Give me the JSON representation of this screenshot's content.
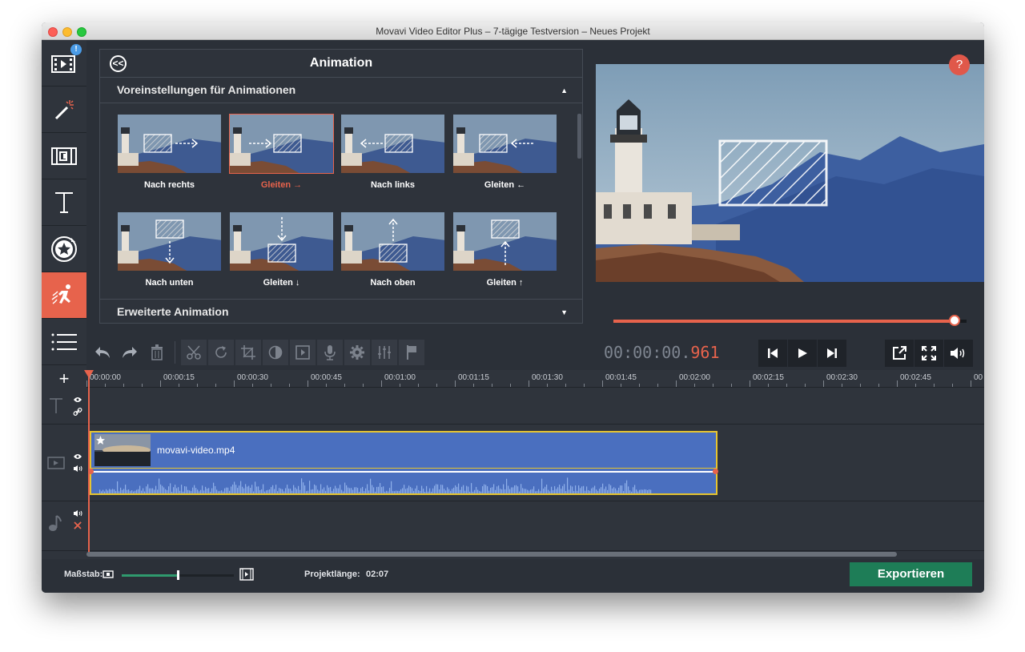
{
  "window": {
    "title": "Movavi Video Editor Plus – 7-tägige Testversion – Neues Projekt"
  },
  "sidebar": {
    "items": [
      {
        "name": "import-media",
        "icon": "film-import-icon",
        "badge": "!"
      },
      {
        "name": "magic-enhance",
        "icon": "magic-wand-icon"
      },
      {
        "name": "transitions",
        "icon": "transition-film-icon"
      },
      {
        "name": "titles",
        "icon": "text-t-icon"
      },
      {
        "name": "stickers",
        "icon": "star-sticker-icon"
      },
      {
        "name": "animation",
        "icon": "running-figure-icon",
        "active": true
      },
      {
        "name": "more-tools",
        "icon": "list-icon"
      }
    ]
  },
  "panel": {
    "title": "Animation",
    "presets_header": "Voreinstellungen für Animationen",
    "advanced_header": "Erweiterte Animation",
    "presets": [
      {
        "label": "Nach rechts",
        "arrow": "right",
        "selected": false
      },
      {
        "label": "Gleiten →",
        "arrow": "right-into",
        "selected": true
      },
      {
        "label": "Nach links",
        "arrow": "left",
        "selected": false
      },
      {
        "label": "Gleiten ←",
        "arrow": "left-into",
        "selected": false
      },
      {
        "label": "Nach unten",
        "arrow": "down",
        "selected": false
      },
      {
        "label": "Gleiten ↓",
        "arrow": "down-into",
        "selected": false
      },
      {
        "label": "Nach oben",
        "arrow": "up",
        "selected": false
      },
      {
        "label": "Gleiten ↑",
        "arrow": "up-into",
        "selected": false
      }
    ]
  },
  "preview": {
    "help": "?",
    "progress": 0.967
  },
  "playback": {
    "timecode_main": "00:00:00.",
    "timecode_ms": "961"
  },
  "timeline": {
    "ticks": [
      "00:00:00",
      "00:00:15",
      "00:00:30",
      "00:00:45",
      "00:01:00",
      "00:01:15",
      "00:01:30",
      "00:01:45",
      "00:02:00",
      "00:02:15",
      "00:02:30",
      "00:02:45",
      "00"
    ],
    "clip_name": "movavi-video.mp4"
  },
  "footer": {
    "scale_label": "Maßstab:",
    "length_label": "Projektlänge:",
    "length_value": "02:07",
    "export_label": "Exportieren"
  },
  "colors": {
    "accent": "#e7634c",
    "export": "#1e7d57",
    "clip": "#4a6fbf",
    "clip_border": "#e6c430"
  }
}
